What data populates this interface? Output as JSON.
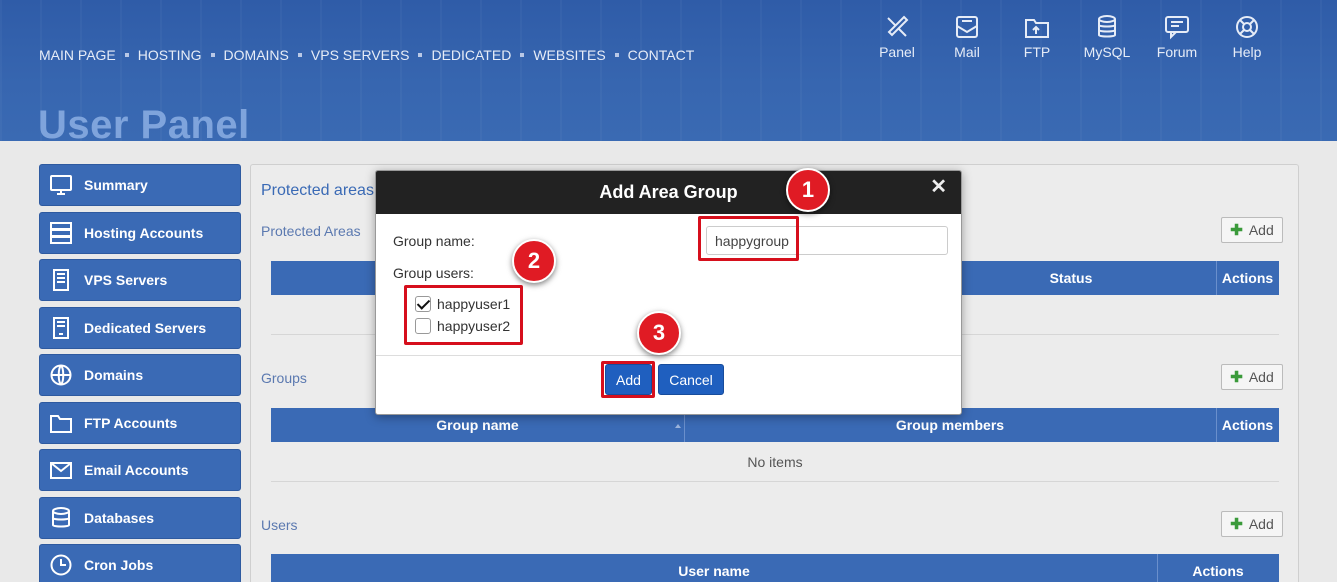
{
  "topnav": [
    "MAIN PAGE",
    "HOSTING",
    "DOMAINS",
    "VPS SERVERS",
    "DEDICATED",
    "WEBSITES",
    "CONTACT"
  ],
  "icon_nav": [
    {
      "label": "Panel",
      "icon": "tools-icon"
    },
    {
      "label": "Mail",
      "icon": "mail-icon"
    },
    {
      "label": "FTP",
      "icon": "ftp-folder-icon"
    },
    {
      "label": "MySQL",
      "icon": "database-icon"
    },
    {
      "label": "Forum",
      "icon": "chat-icon"
    },
    {
      "label": "Help",
      "icon": "lifebuoy-icon"
    }
  ],
  "page_title": "User Panel",
  "sidebar": [
    {
      "label": "Summary",
      "icon": "monitor-icon"
    },
    {
      "label": "Hosting Accounts",
      "icon": "server-stack-icon"
    },
    {
      "label": "VPS Servers",
      "icon": "vps-icon"
    },
    {
      "label": "Dedicated Servers",
      "icon": "dedicated-icon"
    },
    {
      "label": "Domains",
      "icon": "www-globe-icon"
    },
    {
      "label": "FTP Accounts",
      "icon": "ftp-folder-icon"
    },
    {
      "label": "Email Accounts",
      "icon": "envelope-icon"
    },
    {
      "label": "Databases",
      "icon": "database-icon"
    },
    {
      "label": "Cron Jobs",
      "icon": "clock-icon"
    }
  ],
  "main": {
    "title": "Protected areas",
    "protected_areas": {
      "label": "Protected Areas",
      "add": "Add",
      "col_status": "Status",
      "col_actions": "Actions"
    },
    "groups": {
      "label": "Groups",
      "add": "Add",
      "col_name": "Group name",
      "col_members": "Group members",
      "col_actions": "Actions",
      "empty": "No items"
    },
    "users": {
      "label": "Users",
      "add": "Add",
      "col_name": "User name",
      "col_actions": "Actions"
    }
  },
  "modal": {
    "title": "Add Area Group",
    "close": "✕",
    "group_name_label": "Group name:",
    "group_name_value": "happygroup",
    "group_users_label": "Group users:",
    "users": [
      {
        "name": "happyuser1",
        "checked": true
      },
      {
        "name": "happyuser2",
        "checked": false
      }
    ],
    "add_button": "Add",
    "cancel_button": "Cancel"
  },
  "annotations": [
    "1",
    "2",
    "3"
  ],
  "colors": {
    "accent": "#3a6ab5",
    "header": "#2f5ca8",
    "badge": "#e01b24",
    "button": "#1f5fbf"
  }
}
